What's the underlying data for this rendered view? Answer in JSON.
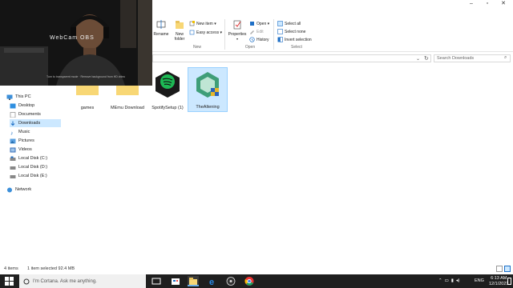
{
  "webcam": {
    "overlay_text": "WebCam OBS",
    "small_text": "Turn to transparent mode · Remove background from HD video"
  },
  "ribbon": {
    "rename": "Rename",
    "new_folder": "New folder",
    "new_item": "New item ▾",
    "easy_access": "Easy access ▾",
    "new_group": "New",
    "properties": "Properties",
    "open": "Open ▾",
    "edit": "Edit",
    "history": "History",
    "open_group": "Open",
    "select_all": "Select all",
    "select_none": "Select none",
    "invert_selection": "Invert selection",
    "select_group": "Select"
  },
  "addressbar": {
    "search_placeholder": "Search Downloads"
  },
  "nav": {
    "this_pc": "This PC",
    "items": [
      "Desktop",
      "Documents",
      "Downloads",
      "Music",
      "Pictures",
      "Videos",
      "Local Disk (C:)",
      "Local Disk (D:)",
      "Local Disk (E:)"
    ],
    "network": "Network"
  },
  "files": [
    {
      "name": "games",
      "type": "folder"
    },
    {
      "name": "MEmu Download",
      "type": "folder"
    },
    {
      "name": "SpotifySetup (1)",
      "type": "spotify"
    },
    {
      "name": "TheAltening",
      "type": "altening"
    }
  ],
  "status": {
    "count": "4 items",
    "selected": "1 item selected  92.4 MB"
  },
  "taskbar": {
    "search_placeholder": "I'm Cortana. Ask me anything.",
    "lang": "ENG",
    "time": "6:13 AM",
    "date": "12/1/2021"
  },
  "colors": {
    "accent": "#0078d7",
    "selection": "#cce8ff",
    "folder": "#f8d775",
    "spotify": "#1db954",
    "taskbar": "#1f1f1f"
  }
}
